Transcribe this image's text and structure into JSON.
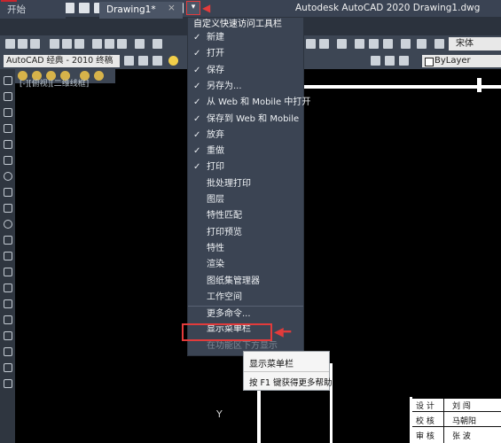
{
  "title_bar": {
    "app_logo": "A",
    "title": "Autodesk AutoCAD 2020    Drawing1.dwg",
    "qat_customize_icon": "▾"
  },
  "tabs": [
    {
      "label": "开始"
    },
    {
      "label": "Drawing1*"
    }
  ],
  "tab_close": "×",
  "toolbar": {
    "workspace_value": "AutoCAD 经典 - 2010 终稿",
    "font_value": "宋体",
    "layer_value": "ByLayer"
  },
  "viewport_label": "[-][俯视][二维线框]",
  "qat_menu": {
    "title": "自定义快速访问工具栏",
    "items": [
      {
        "label": "新建",
        "check": "✓"
      },
      {
        "label": "打开",
        "check": "✓"
      },
      {
        "label": "保存",
        "check": "✓"
      },
      {
        "label": "另存为...",
        "check": "✓"
      },
      {
        "label": "从 Web 和 Mobile 中打开",
        "check": "✓"
      },
      {
        "label": "保存到 Web 和 Mobile",
        "check": "✓"
      },
      {
        "label": "放弃",
        "check": "✓"
      },
      {
        "label": "重做",
        "check": "✓"
      },
      {
        "label": "打印",
        "check": "✓"
      },
      {
        "label": "批处理打印",
        "check": ""
      },
      {
        "label": "图层",
        "check": ""
      },
      {
        "label": "特性匹配",
        "check": ""
      },
      {
        "label": "打印预览",
        "check": ""
      },
      {
        "label": "特性",
        "check": ""
      },
      {
        "label": "渲染",
        "check": ""
      },
      {
        "label": "图纸集管理器",
        "check": ""
      },
      {
        "label": "工作空间",
        "check": ""
      },
      {
        "label": "更多命令...",
        "check": ""
      },
      {
        "label": "显示菜单栏",
        "check": ""
      },
      {
        "label": "在功能区下方显示",
        "check": ""
      }
    ]
  },
  "tooltip": {
    "title": "显示菜单栏",
    "help": "按 F1 键获得更多帮助"
  },
  "title_block": [
    {
      "key": "设 计",
      "value": "刘 闯"
    },
    {
      "key": "校 核",
      "value": "马朝阳"
    },
    {
      "key": "审 核",
      "value": "张 波"
    }
  ],
  "y_axis_label": "Y",
  "colors": {
    "accent_red": "#e23b3b",
    "menu_bg": "#3b4453",
    "titlebar_bg": "#3a4353"
  }
}
